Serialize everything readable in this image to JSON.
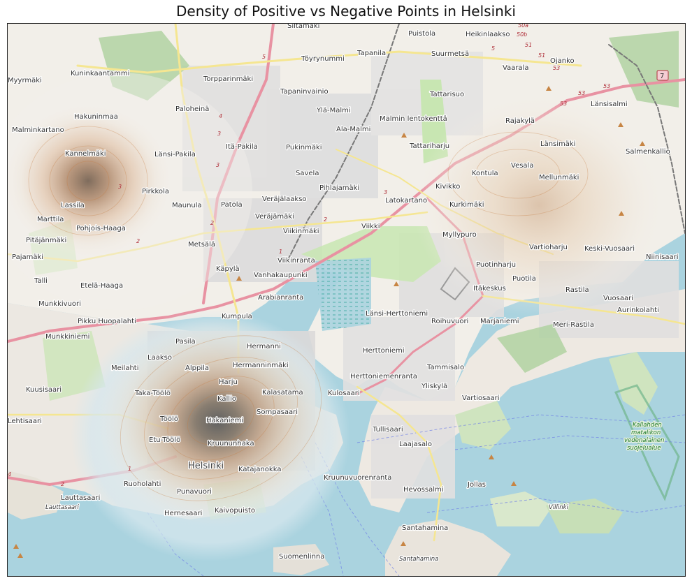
{
  "title": "Density of Positive vs Negative Points in Helsinki",
  "colors": {
    "water": "#aad3df",
    "land": "#f2efe9",
    "urban": "#e0dfdf",
    "park": "#c8e6b2",
    "forest": "#add19e",
    "motorway": "#e892a2",
    "primary": "#f5e691",
    "density_negative_low": "#d8e7ec",
    "density_positive_mid": "#d9a77a",
    "density_core": "#5a5a5a"
  },
  "labels": {
    "siltamaki": "Siltamäki",
    "puistola": "Puistola",
    "heikinlaakso": "Heikinlaakso",
    "myyrmaki": "Myyrmäki",
    "kuninkaantammi": "Kuninkaantammi",
    "toyrynummi": "Töyrynummi",
    "tapanila": "Tapanila",
    "suurmetsa": "Suurmetsä",
    "vaarala": "Vaarala",
    "ojanko": "Ojanko",
    "torpparinmaki": "Torpparinmäki",
    "tapaninvainio": "Tapaninvainio",
    "tattarisuo": "Tattarisuo",
    "lansisalmi": "Länsisalmi",
    "hakuninmaa": "Hakuninmaa",
    "paloheina": "Paloheinä",
    "yla_malmi": "Ylä-Malmi",
    "malmin_lentokentta": "Malmin lentokenttä",
    "rajakyla": "Rajakylä",
    "malminkartano": "Malminkartano",
    "ala_malmi": "Ala-Malmi",
    "lansimaki": "Länsimäki",
    "kannelmaki": "Kannelmäki",
    "lansi_pakila": "Länsi-Pakila",
    "ita_pakila": "Itä-Pakila",
    "pukinmaki": "Pukinmäki",
    "tattariharju": "Tattariharju",
    "salmenkallio": "Salmenkallio",
    "kontula": "Kontula",
    "vesala": "Vesala",
    "mellunmaki": "Mellunmäki",
    "savela": "Savela",
    "pirkkola": "Pirkkola",
    "pihlajamaki": "Pihlajamäki",
    "kivikko": "Kivikko",
    "lassila": "Lassila",
    "maunula": "Maunula",
    "patola": "Patola",
    "verajalaakso": "Veräjälaakso",
    "latokartano": "Latokartano",
    "kurkimaki": "Kurkimäki",
    "verajamaki": "Veräjämäki",
    "marttila": "Marttila",
    "pohjois_haaga": "Pohjois-Haaga",
    "viikki": "Viikki",
    "viikinmaki": "Viikinmäki",
    "myllypuro": "Myllypuro",
    "pitajanmaki": "Pitäjänmäki",
    "metsala": "Metsälä",
    "vartioharju": "Vartioharju",
    "keski_vuosaari": "Keski-Vuosaari",
    "niinisaari": "Niinisaari",
    "pajamaki": "Pajamäki",
    "kapyla": "Käpylä",
    "viikinranta": "Viikinranta",
    "puotinharju": "Puotinharju",
    "vanhakaupunki": "Vanhakaupunki",
    "puotila": "Puotila",
    "talli": "Talli",
    "etela_haaga": "Etelä-Haaga",
    "itakeskus": "Itäkeskus",
    "rastila": "Rastila",
    "munkkivuori": "Munkkivuori",
    "arabianranta": "Arabianranta",
    "vuosaari": "Vuosaari",
    "aurinkolahti": "Aurinkolahti",
    "lansi_herttoniemi": "Länsi-Herttoniemi",
    "kumpula": "Kumpula",
    "pikku_huopalahti": "Pikku Huopalahti",
    "roihuvuori": "Roihuvuori",
    "marjaniemi": "Marjaniemi",
    "meri_rastila": "Meri-Rastila",
    "munkkiniemi": "Munkkiniemi",
    "pasila": "Pasila",
    "hermanni": "Hermanni",
    "herttoniemi": "Herttoniemi",
    "laakso": "Laakso",
    "meilahti": "Meilahti",
    "alppila": "Alppila",
    "hermanninmaki": "Hermanninmäki",
    "tammisalo": "Tammisalo",
    "herttoniemenranta": "Herttoniemenranta",
    "harju": "Harju",
    "kuusisaari": "Kuusisaari",
    "taka_toolo": "Taka-Töölö",
    "kallio": "Kallio",
    "kalasatama": "Kalasatama",
    "kulosaari": "Kulosaari",
    "yliskyla": "Yliskylä",
    "vartiosaari": "Vartiosaari",
    "sompasaari": "Sompasaari",
    "lehtisaari": "Lehtisaari",
    "toolo": "Töölö",
    "hakaniemi": "Hakaniemi",
    "kallahden_1": "Kallahden",
    "kallahden_2": "matalikon",
    "kallahden_3": "vedenalainen",
    "kallahden_4": "suojelualue",
    "tullisaari": "Tullisaari",
    "etu_toolo": "Etu-Töölö",
    "kruununhaka": "Kruununhaka",
    "laajasalo": "Laajasalo",
    "helsinki": "Helsinki",
    "katajanokka": "Katajanokka",
    "kruunuvuorenranta": "Kruunuvuorenranta",
    "ruoholahti": "Ruoholahti",
    "jollas": "Jollas",
    "hevossalmi": "Hevossalmi",
    "lauttasaari": "Lauttasaari",
    "lauttasaari_it": "Lauttasaari",
    "punavuori": "Punavuori",
    "villinki": "Villinki",
    "hernesaari": "Hernesaari",
    "kaivopuisto": "Kaivopuisto",
    "santahamina": "Santahamina",
    "santahamina_it": "Santahamina",
    "suomenlinna": "Suomenlinna",
    "road_50a": "50a",
    "road_50b": "50b",
    "road_51a": "51",
    "road_51b": "51",
    "road_53a": "53",
    "road_53b": "53",
    "road_53c": "53",
    "road_53d": "53",
    "road_7": "7",
    "road_5a": "5",
    "road_5b": "5",
    "road_3a": "3",
    "road_3b": "3",
    "road_3c": "3",
    "road_3d": "3",
    "road_2a": "2",
    "road_2b": "2",
    "road_2c": "2",
    "road_1a": "1",
    "road_1b": "1",
    "road_4a": "4",
    "road_4b": "4",
    "road_2d": "2"
  }
}
